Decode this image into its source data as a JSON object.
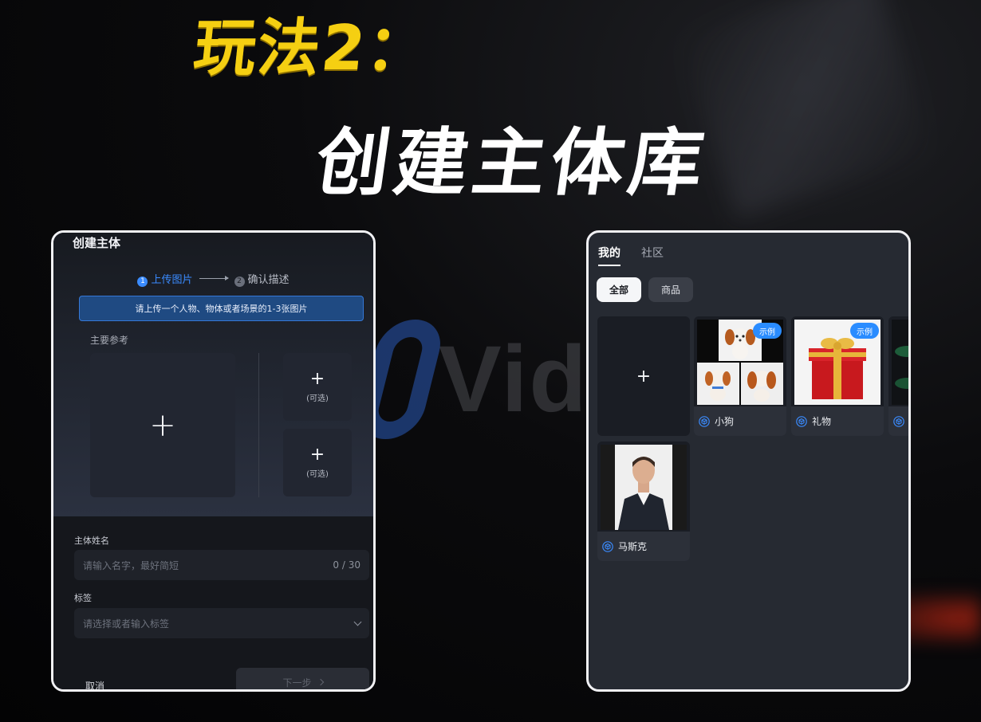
{
  "headline": {
    "line1": "玩法2：",
    "line2": "创建主体库"
  },
  "background_logo": "Vid",
  "create_panel": {
    "title": "创建主体",
    "steps": [
      {
        "num": "1",
        "label": "上传图片"
      },
      {
        "num": "2",
        "label": "确认描述"
      }
    ],
    "upload_tip": "请上传一个人物、物体或者场景的1-3张图片",
    "main_ref_label": "主要参考",
    "main_slot_plus": "+",
    "optional_slots": [
      {
        "plus": "+",
        "label": "(可选)"
      },
      {
        "plus": "+",
        "label": "(可选)"
      }
    ],
    "name_field": {
      "label": "主体姓名",
      "placeholder": "请输入名字，最好简短",
      "counter": "0 / 30"
    },
    "tag_field": {
      "label": "标签",
      "placeholder": "请选择或者输入标签"
    },
    "cancel_label": "取消",
    "next_label": "下一步"
  },
  "library_panel": {
    "tabs": [
      {
        "label": "我的",
        "active": true
      },
      {
        "label": "社区",
        "active": false
      }
    ],
    "filters": [
      {
        "label": "全部",
        "active": true
      },
      {
        "label": "商品",
        "active": false
      }
    ],
    "add_plus": "+",
    "cards": [
      {
        "name": "小狗",
        "badge": "示例"
      },
      {
        "name": "礼物",
        "badge": "示例"
      },
      {
        "name": "马斯克",
        "badge": ""
      }
    ]
  },
  "colors": {
    "accent_blue": "#2a8cff",
    "headline_yellow": "#f5cf12",
    "panel_border": "#f1f1f4"
  }
}
